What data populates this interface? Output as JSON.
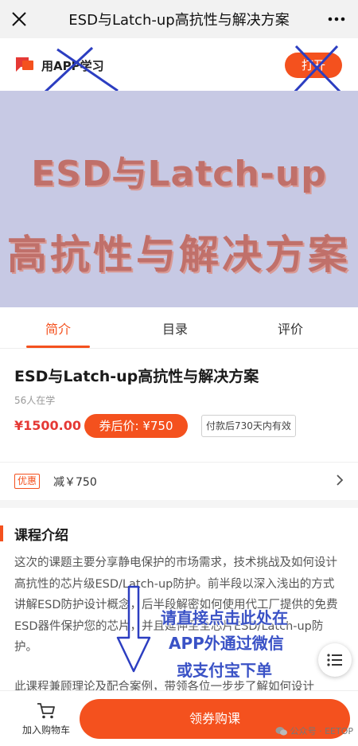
{
  "window": {
    "title": "ESD与Latch-up高抗性与解决方案",
    "close_icon": "close-icon",
    "more_icon": "more-icon"
  },
  "app_promo": {
    "label": "用APP学习",
    "open_button": "打开",
    "brand_color": "#f4511e"
  },
  "banner": {
    "line1": "ESD与Latch-up",
    "line2": "高抗性与解决方案",
    "background": "#c7c9e4",
    "text_color": "#c0706a"
  },
  "tabs": [
    {
      "label": "简介",
      "active": true
    },
    {
      "label": "目录",
      "active": false
    },
    {
      "label": "评价",
      "active": false
    }
  ],
  "course": {
    "title": "ESD与Latch-up高抗性与解决方案",
    "learners": "56人在学",
    "price": "¥1500.00",
    "coupon_price": "券后价: ¥750",
    "validity": "付款后730天内有效"
  },
  "promo": {
    "tag": "优惠",
    "text": "减￥750"
  },
  "intro": {
    "heading": "课程介绍",
    "paragraph": "这次的课题主要分享静电保护的市场需求，技术挑战及如何设计高抗性的芯片级ESD/Latch-up防护。前半段以深入浅出的方式讲解ESD防护设计概念，后半段解密如何使用代工厂提供的免费ESD器件保护您的芯片，并且延伸至全芯片ESD/Latch-up防护。",
    "paragraph2": "此课程兼顾理论及配合案例，带领各位一步步了解如何设计"
  },
  "overlay": {
    "line1": "请直接点击此处在",
    "line2": "APP外通过微信",
    "line3": "或支付宝下单",
    "color": "#3a52c6"
  },
  "bottom_bar": {
    "cart_label": "加入购物车",
    "buy_button": "领券购课",
    "watermark": "公众号 · EETOP"
  }
}
